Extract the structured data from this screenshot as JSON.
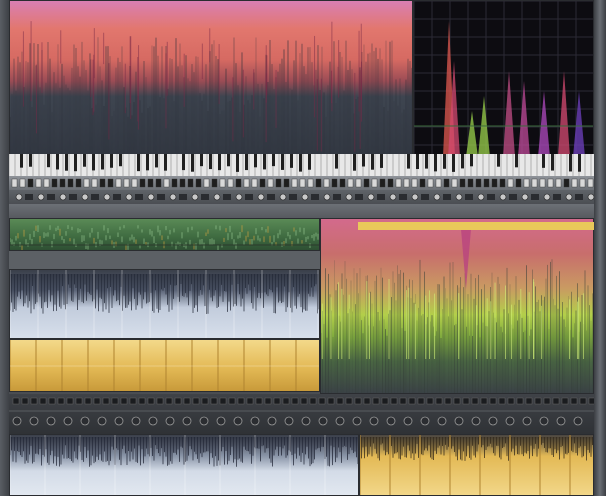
{
  "colors": {
    "spectrogram_top": "#e2776e",
    "spectrogram_mid": "#9b4c55",
    "analyzer_bg": "#0d0c11",
    "keyboard_white": "#e8e8e8",
    "track_green": "#4e7a4c",
    "track_blue": "#c2ccdc",
    "track_gold": "#e3b955",
    "spectrum_lime": "#b3cf4a",
    "spectrum_magenta": "#d36a8c"
  },
  "panels": {
    "top_spectrogram": {
      "icon": "spectrogram-icon"
    },
    "analyzer": {
      "icon": "frequency-analyzer-icon"
    },
    "piano_keys": {
      "icon": "piano-keyboard-icon"
    },
    "transport": {
      "icon": "transport-controls-icon"
    }
  },
  "tracks": [
    {
      "id": "green",
      "color": "#4e7a4c"
    },
    {
      "id": "blue",
      "color": "#c2ccdc"
    },
    {
      "id": "gold",
      "color": "#e3b955"
    },
    {
      "id": "blue-bottom",
      "color": "#c2ccdc"
    },
    {
      "id": "gold-bottom",
      "color": "#e3b955"
    }
  ]
}
